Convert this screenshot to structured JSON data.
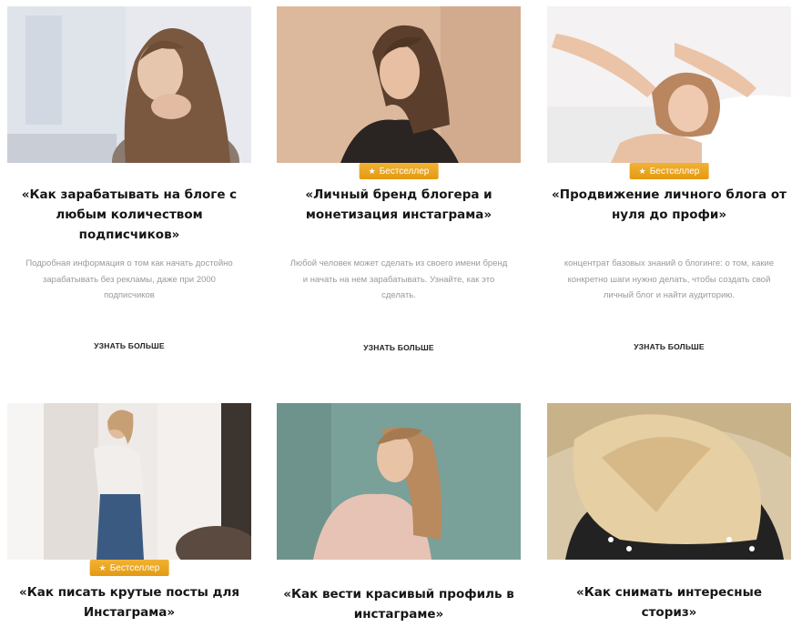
{
  "colors": {
    "badge": "#eba424",
    "title": "#161616",
    "description": "#9a9a9a",
    "link": "#222222"
  },
  "cards": [
    {
      "title": "«Как зарабатывать на блоге с любым количеством подписчиков»",
      "description": "Подробная информация о том как начать достойно зарабатывать без рекламы, даже при 2000 подписчиков",
      "button": "УЗНАТЬ БОЛЬШЕ",
      "badge": ""
    },
    {
      "title": "«Личный бренд блогера и монетизация инстаграма»",
      "description": "Любой человек может сделать из своего имени бренд и начать на нем зарабатывать. Узнайте, как это сделать.",
      "button": "УЗНАТЬ БОЛЬШЕ",
      "badge": "Бестселлер"
    },
    {
      "title": "«Продвижение личного блога от нуля до профи»",
      "description": "концентрат базовых знаний о блогинге: о том, какие конкретно шаги нужно делать, чтобы создать свой личный блог и найти аудиторию.",
      "button": "УЗНАТЬ БОЛЬШЕ",
      "badge": "Бестселлер"
    },
    {
      "title": "«Как писать крутые посты для Инстаграма»",
      "badge": "Бестселлер"
    },
    {
      "title": "«Как вести красивый профиль в инстаграме»",
      "badge": ""
    },
    {
      "title": "«Как снимать интересные сториз»",
      "badge": ""
    }
  ]
}
